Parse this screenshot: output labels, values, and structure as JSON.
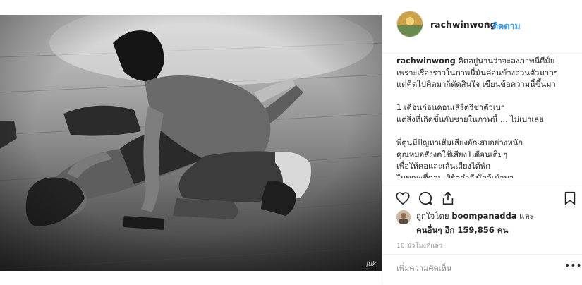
{
  "post": {
    "username": "rachwinwong",
    "separator": "•",
    "follow_label": "ติดตาม",
    "caption_lines": [
      "คิดอยู่นานว่าจะลงภาพนี้ดีมั้ย",
      "เพราะเรื่องราวในภาพนี้มันค่อนข้างส่วนตัวมากๆ",
      "แต่คิดไปคิดมาก็ตัดสินใจ เขียนข้อความนี้ขึ้นมา",
      "",
      "1 เดือนก่อนคอนเสิร์ตวิชาตัวเบา",
      "แต่สิ่งที่เกิดขึ้นกับชายในภาพนี้ ... ไม่เบาเลย",
      "",
      "พี่ตูนมีปัญหาเส้นเสียงอักเสบอย่างหนัก",
      "คุณหมอสั่งงดใช้เสียง1เดือนเต็มๆ",
      "เพื่อให้คอและเส้นเสียงได้พัก",
      "ในขณะที่คอนเสิร์ตกำลังใกล้เข้ามา"
    ],
    "likes_line1_prefix": "ถูกใจโดย",
    "liked_by_user": "boompanadda",
    "likes_line1_suffix": "และ",
    "likes_others_label": "คนอื่นๆ อีก 159,856 คน",
    "time_ago": "10 ชั่วโมงที่แล้ว",
    "comment_placeholder": "เพิ่มความคิดเห็น",
    "more_label": "•••",
    "photo_signature": "Juk"
  },
  "icons": {
    "like": "heart-icon",
    "comment": "comment-icon",
    "share": "share-icon",
    "save": "bookmark-icon"
  },
  "colors": {
    "accent": "#3897f0",
    "text": "#262626",
    "muted": "#999999",
    "border": "#efefef"
  }
}
